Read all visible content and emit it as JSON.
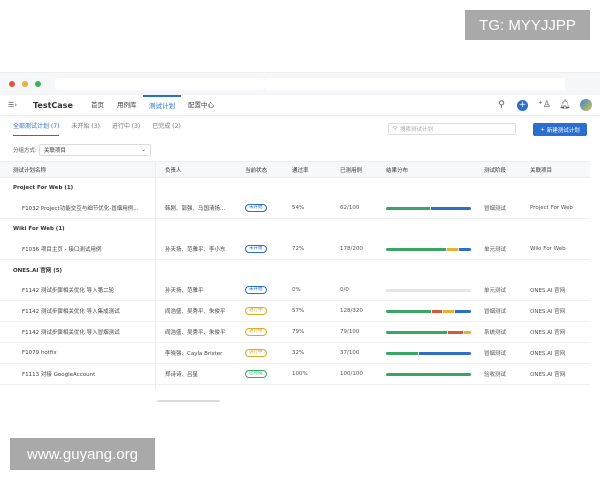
{
  "watermarks": {
    "top": "TG: MYYJJPP",
    "bottom": "www.guyang.org"
  },
  "app": {
    "brand": "TestCase",
    "nav": [
      "首页",
      "用例库",
      "测试计划",
      "配置中心"
    ],
    "active_nav": 2
  },
  "tabs": [
    {
      "label": "全部测试计划 (7)",
      "active": true
    },
    {
      "label": "未开始 (3)"
    },
    {
      "label": "进行中 (3)"
    },
    {
      "label": "已完成 (2)"
    }
  ],
  "search": {
    "placeholder": "搜索测试计划"
  },
  "new_button": "新建测试计划",
  "groupby": {
    "label": "分组方式:",
    "value": "关联项目"
  },
  "columns": [
    "测试计划名称",
    "负责人",
    "当前状态",
    "通过率",
    "已测用例",
    "结果分布",
    "测试阶段",
    "关联项目"
  ],
  "colors": {
    "accent": "#2a6ecf",
    "pass": "#3aa564",
    "fail": "#d65a3a",
    "blocked": "#e6b230",
    "untested": "#2f6fc4"
  },
  "groups": [
    {
      "title": "Project For Web (1)",
      "rows": [
        {
          "name": "F1032 Project功能交互与细节优化-冒烟用例...",
          "owner": "韩刚、郭强、马国清扬...",
          "status": "未开始",
          "status_type": "todo",
          "pass": "54%",
          "tested": "62/100",
          "dist": [
            0.52,
            0,
            0,
            0.48
          ],
          "stage": "冒烟测试",
          "project": "Project For Web"
        }
      ]
    },
    {
      "title": "Wiki For Web (1)",
      "rows": [
        {
          "name": "F1036 项目主页 - 接口测试用例",
          "owner": "孙天扬、范雅平、李小东",
          "status": "未开始",
          "status_type": "todo",
          "pass": "72%",
          "tested": "178/200",
          "dist": [
            0.72,
            0,
            0.13,
            0.15
          ],
          "stage": "单元测试",
          "project": "Wiki For Web"
        }
      ]
    },
    {
      "title": "ONES.AI 官网 (5)",
      "rows": [
        {
          "name": "F1142 测试步骤相关优化 导入第二轮",
          "owner": "孙天扬、范雅平",
          "status": "未开始",
          "status_type": "todo",
          "pass": "0%",
          "tested": "0/0",
          "dist": [
            0,
            0,
            0,
            0
          ],
          "stage": "单元测试",
          "project": "ONES.AI 官网"
        },
        {
          "name": "F1142 测试步骤相关优化 导入集成测试",
          "owner": "阎浩盛、吴秀平、朱俊平",
          "status": "进行中",
          "status_type": "doing",
          "pass": "57%",
          "tested": "128/320",
          "dist": [
            0.55,
            0.12,
            0.13,
            0.2
          ],
          "stage": "冒烟测试",
          "project": "ONES.AI 官网"
        },
        {
          "name": "F1142 测试步骤相关优化 导入冒烟测试",
          "owner": "阎浩盛、吴秀平、朱俊平",
          "status": "进行中",
          "status_type": "doing",
          "pass": "79%",
          "tested": "79/100",
          "dist": [
            0.73,
            0.19,
            0.08,
            0
          ],
          "stage": "系统测试",
          "project": "ONES.AI 官网"
        },
        {
          "name": "F1079 hotfix",
          "owner": "李晓强、Cayla Brister",
          "status": "进行中",
          "status_type": "doing",
          "pass": "32%",
          "tested": "37/100",
          "dist": [
            0.38,
            0,
            0,
            0.62
          ],
          "stage": "冒烟测试",
          "project": "ONES.AI 官网"
        },
        {
          "name": "F1113 对接 GoogleAccount",
          "owner": "郑诗诗、吕星",
          "status": "已完成",
          "status_type": "done",
          "pass": "100%",
          "tested": "100/100",
          "dist": [
            1,
            0,
            0,
            0
          ],
          "stage": "验收测试",
          "project": "ONES.AI 官网"
        }
      ]
    }
  ]
}
